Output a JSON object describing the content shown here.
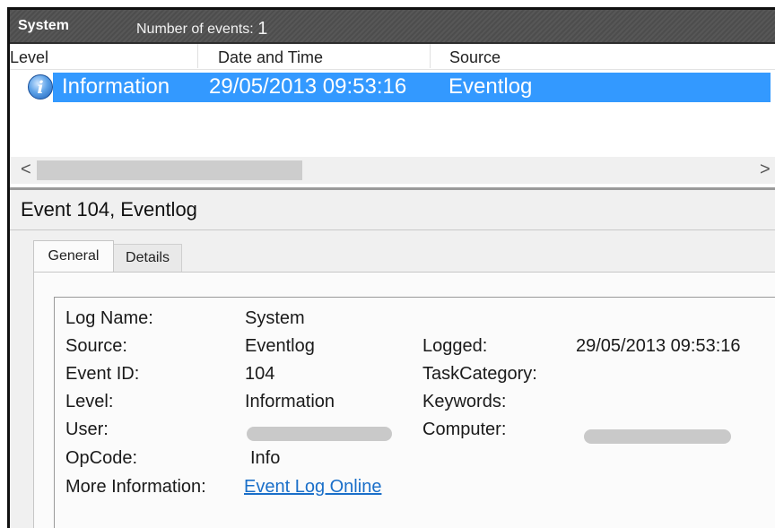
{
  "titlebar": {
    "log": "System",
    "events_label": "Number of events:",
    "events_count": "1"
  },
  "columns": [
    "Level",
    "Date and Time",
    "Source"
  ],
  "selected_event": {
    "level": "Information",
    "datetime": "29/05/2013 09:53:16",
    "source": "Eventlog",
    "icon": "info-icon"
  },
  "scroll": {
    "left": "<",
    "right": ">"
  },
  "detail": {
    "title": "Event 104, Eventlog",
    "tabs": [
      "General",
      "Details"
    ],
    "fields": {
      "log_name_label": "Log Name:",
      "log_name": "System",
      "source_label": "Source:",
      "source": "Eventlog",
      "event_id_label": "Event ID:",
      "event_id": "104",
      "level_label": "Level:",
      "level": "Information",
      "user_label": "User:",
      "opcode_label": "OpCode:",
      "opcode": "Info",
      "more_info_label": "More Information:",
      "more_info_link": "Event Log Online",
      "logged_label": "Logged:",
      "logged": "29/05/2013 09:53:16",
      "task_category_label": "TaskCategory:",
      "keywords_label": "Keywords:",
      "computer_label": "Computer:"
    }
  },
  "colors": {
    "selection": "#3399ff",
    "titlebar": "#4d4d4d",
    "link": "#1a6fc9"
  }
}
